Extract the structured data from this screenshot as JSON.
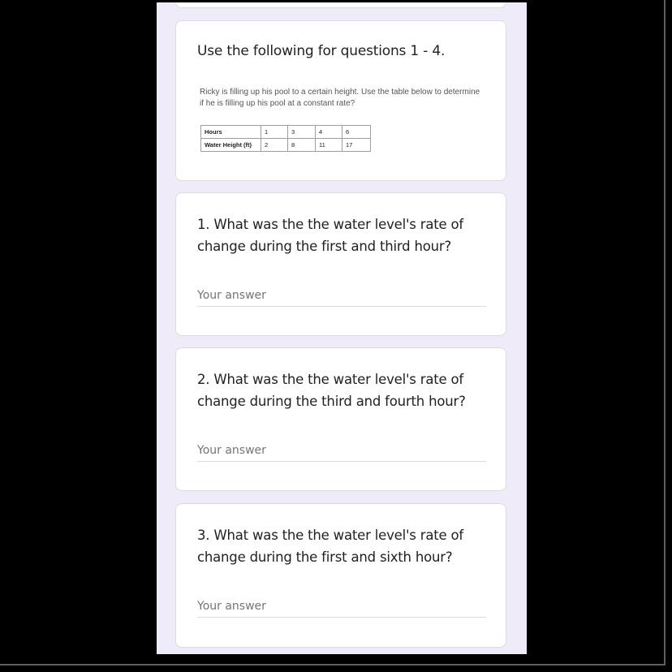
{
  "section": {
    "title": "Use the following for questions 1 - 4.",
    "problem_text": "Ricky is filling up his pool to a certain height.  Use the table below to determine if he is filling up his pool at a constant rate?",
    "table": {
      "rows": [
        {
          "label": "Hours",
          "values": [
            "1",
            "3",
            "4",
            "6"
          ]
        },
        {
          "label": "Water Height (ft)",
          "values": [
            "2",
            "8",
            "11",
            "17"
          ]
        }
      ]
    }
  },
  "questions": [
    {
      "text": "1. What was the the water level's rate of change during the first and third hour?",
      "placeholder": "Your answer"
    },
    {
      "text": "2. What was the the water level's rate of change during the third and fourth hour?",
      "placeholder": "Your answer"
    },
    {
      "text": "3. What was the the water level's rate of change during the first and sixth hour?",
      "placeholder": "Your answer"
    }
  ],
  "colors": {
    "page_background": "#f0ebf8",
    "card_background": "#ffffff",
    "outer_background": "#000000",
    "text_primary": "#202124",
    "text_placeholder": "#70757a"
  }
}
